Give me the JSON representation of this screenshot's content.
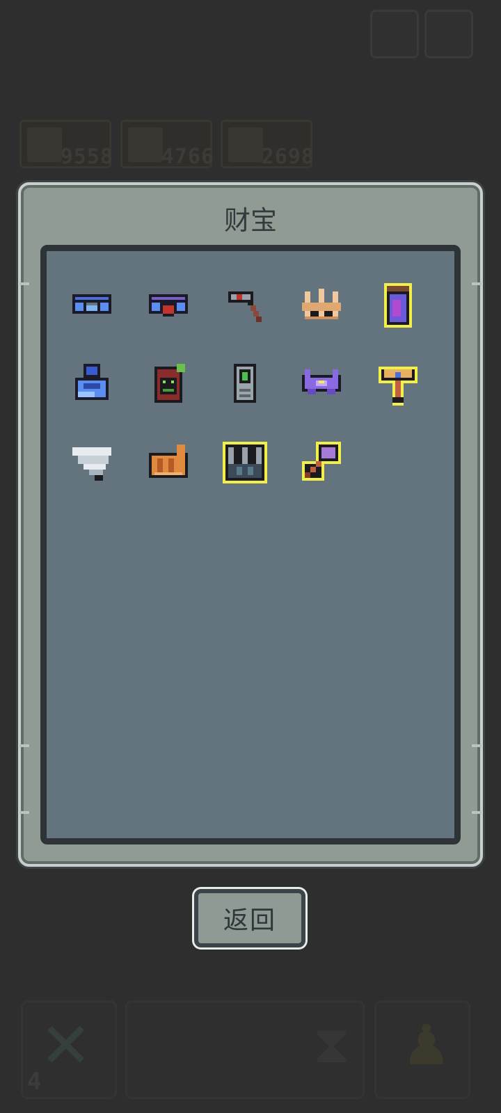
{
  "panel": {
    "title": "财宝",
    "items": [
      {
        "name": "blue-goggles-icon",
        "highlighted": false
      },
      {
        "name": "red-orb-goggles-icon",
        "highlighted": false
      },
      {
        "name": "hammer-icon",
        "highlighted": false
      },
      {
        "name": "bone-crown-icon",
        "highlighted": false
      },
      {
        "name": "potion-jar-icon",
        "highlighted": true
      },
      {
        "name": "blue-bird-icon",
        "highlighted": false
      },
      {
        "name": "hooded-slime-icon",
        "highlighted": false
      },
      {
        "name": "handheld-device-icon",
        "highlighted": false
      },
      {
        "name": "purple-bat-icon",
        "highlighted": false
      },
      {
        "name": "golden-chalice-icon",
        "highlighted": true
      },
      {
        "name": "white-tornado-icon",
        "highlighted": false
      },
      {
        "name": "croissant-icon",
        "highlighted": false
      },
      {
        "name": "spiked-crown-icon",
        "highlighted": true
      },
      {
        "name": "purple-axe-icon",
        "highlighted": true
      }
    ]
  },
  "return_button": {
    "label": "返回"
  },
  "background": {
    "resources": [
      {
        "value": "9558",
        "icon": "sword-icon"
      },
      {
        "value": "4766",
        "icon": "creature-icon"
      },
      {
        "value": "2698",
        "icon": "creature-icon"
      }
    ],
    "bottom_counter": "4"
  },
  "colors": {
    "highlight": "#f2ef4a",
    "panel": "#8f9b93",
    "inner": "#64747e"
  }
}
